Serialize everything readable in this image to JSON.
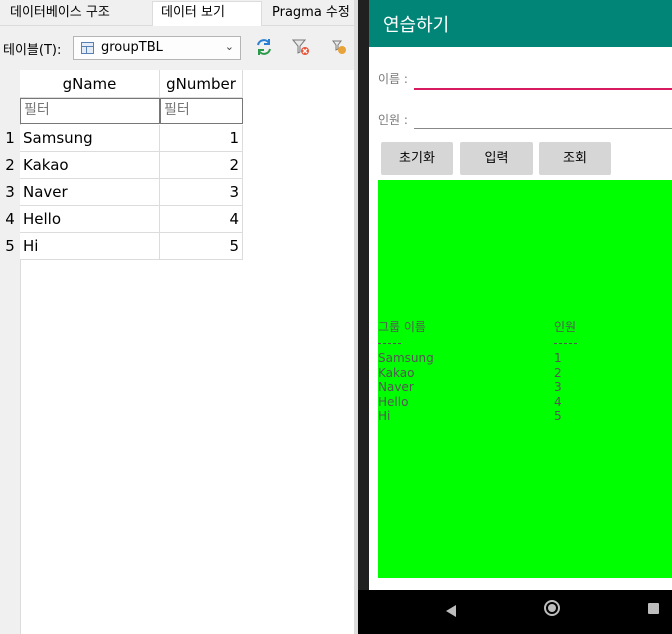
{
  "tabs": [
    "데이터베이스 구조",
    "데이터 보기",
    "Pragma 수정"
  ],
  "toolbar": {
    "table_label": "테이블(T):",
    "table_value": "groupTBL"
  },
  "grid": {
    "columns": [
      "gName",
      "gNumber"
    ],
    "filter_placeholder": "필터",
    "rows": [
      {
        "num": "1",
        "name": "Samsung",
        "number": "1"
      },
      {
        "num": "2",
        "name": "Kakao",
        "number": "2"
      },
      {
        "num": "3",
        "name": "Naver",
        "number": "3"
      },
      {
        "num": "4",
        "name": "Hello",
        "number": "4"
      },
      {
        "num": "5",
        "name": "Hi",
        "number": "5"
      }
    ]
  },
  "app": {
    "title": "연습하기",
    "name_label": "이름 :",
    "count_label": "인원 :",
    "buttons": [
      "초기화",
      "입력",
      "조회"
    ],
    "result": {
      "header_name": "그룹 이름",
      "header_count": "인원",
      "names": [
        "Samsung",
        "Kakao",
        "Naver",
        "Hello",
        "Hi"
      ],
      "counts": [
        "1",
        "2",
        "3",
        "4",
        "5"
      ]
    }
  },
  "colors": {
    "appbar": "#008577",
    "accent": "#d81b60",
    "result_bg": "#00ff00"
  },
  "icons": [
    "table-icon",
    "refresh-icon",
    "clear-filter-icon",
    "save-filter-icon",
    "back-icon",
    "home-icon",
    "recents-icon"
  ]
}
